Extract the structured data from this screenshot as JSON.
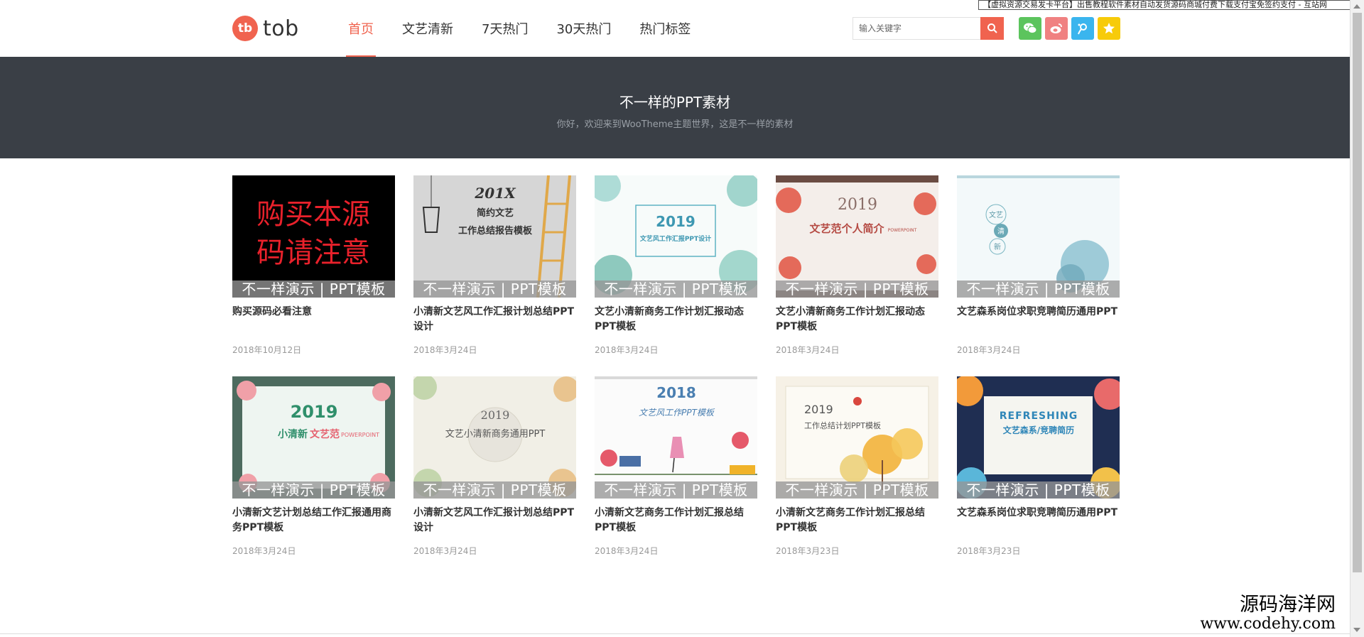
{
  "notice": "【虚拟资源交易发卡平台】出售教程软件素材自动发货源码商城付费下载支付宝免签约支付 - 互站网",
  "logo": {
    "mark": "tb",
    "text": "tob"
  },
  "nav": [
    "首页",
    "文艺清新",
    "7天热门",
    "30天热门",
    "热门标签"
  ],
  "search": {
    "placeholder": "输入关键字"
  },
  "social": [
    {
      "name": "wechat-icon",
      "color": "#5cc45d"
    },
    {
      "name": "weibo-icon",
      "color": "#f08181"
    },
    {
      "name": "tencent-weibo-icon",
      "color": "#3ab5ee"
    },
    {
      "name": "star-icon",
      "color": "#f7cb0a"
    }
  ],
  "hero": {
    "title": "不一样的PPT素材",
    "subtitle": "你好，欢迎来到WooTheme主题世界，这是不一样的素材"
  },
  "watermark": "不一样演示 | PPT模板",
  "cards": [
    {
      "title": "购买源码必看注意",
      "date": "2018年10月12日",
      "thumb": "购买本源码请注意",
      "variant": "black"
    },
    {
      "title": "小清新文艺风工作汇报计划总结PPT设计",
      "date": "2018年3月24日",
      "thumb": "201X 简约文艺 工作总结报告模板",
      "variant": "gray"
    },
    {
      "title": "文艺小清新商务工作计划汇报动态PPT模板",
      "date": "2018年3月24日",
      "thumb": "2019 文艺风工作汇报PPT设计",
      "variant": "teal"
    },
    {
      "title": "文艺小清新商务工作计划汇报动态PPT模板",
      "date": "2018年3月24日",
      "thumb": "2019 文艺范个人简介 POWERPOINT",
      "variant": "red"
    },
    {
      "title": "文艺森系岗位求职竞聘简历通用PPT",
      "date": "2018年3月24日",
      "thumb": "文艺 清 新",
      "variant": "blue"
    },
    {
      "title": "小清新文艺计划总结工作汇报通用商务PPT模板",
      "date": "2018年3月24日",
      "thumb": "2019 小清新文艺范 POWERPOINT",
      "variant": "green"
    },
    {
      "title": "小清新文艺风工作汇报计划总结PPT设计",
      "date": "2018年3月24日",
      "thumb": "2019 文艺小清新商务通用PPT",
      "variant": "beige"
    },
    {
      "title": "小清新文艺商务工作计划汇报总结PPT模板",
      "date": "2018年3月24日",
      "thumb": "2018 文艺风工作PPT模板",
      "variant": "white"
    },
    {
      "title": "小清新文艺商务工作计划汇报总结PPT模板",
      "date": "2018年3月23日",
      "thumb": "2019 工作总结计划PPT模板",
      "variant": "yellow"
    },
    {
      "title": "文艺森系岗位求职竞聘简历通用PPT",
      "date": "2018年3月23日",
      "thumb": "REFRESHING 文艺森系/竞聘简历",
      "variant": "navy"
    }
  ],
  "site_watermark": {
    "cn": "源码海洋网",
    "en": "www.codehy.com"
  }
}
